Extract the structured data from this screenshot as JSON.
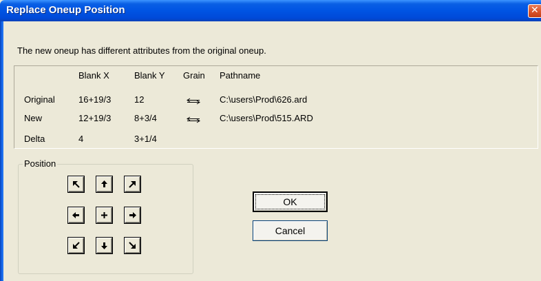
{
  "window": {
    "title": "Replace Oneup Position",
    "close_glyph": "✕"
  },
  "message": "The new oneup has different attributes from the original oneup.",
  "table": {
    "columns": [
      "Blank X",
      "Blank Y",
      "Grain",
      "Pathname"
    ],
    "rows": [
      {
        "label": "Original",
        "blank_x": "16+19/3",
        "blank_y": "12",
        "grain": "grain-arrow-icon",
        "pathname": "C:\\users\\Prod\\626.ard"
      },
      {
        "label": "New",
        "blank_x": "12+19/3",
        "blank_y": "8+3/4",
        "grain": "grain-arrow-icon",
        "pathname": "C:\\users\\Prod\\515.ARD"
      },
      {
        "label": "Delta",
        "blank_x": "4",
        "blank_y": "3+1/4"
      }
    ]
  },
  "position": {
    "label": "Position",
    "buttons": [
      "arrow-up-left-icon",
      "arrow-up-icon",
      "arrow-up-right-icon",
      "arrow-left-icon",
      "plus-center-icon",
      "arrow-right-icon",
      "arrow-down-left-icon",
      "arrow-down-icon",
      "arrow-down-right-icon"
    ]
  },
  "buttons": {
    "ok": "OK",
    "cancel": "Cancel"
  },
  "colors": {
    "titlebar": "#0054e3",
    "dialog_bg": "#ece9d8",
    "close": "#d9532a"
  }
}
